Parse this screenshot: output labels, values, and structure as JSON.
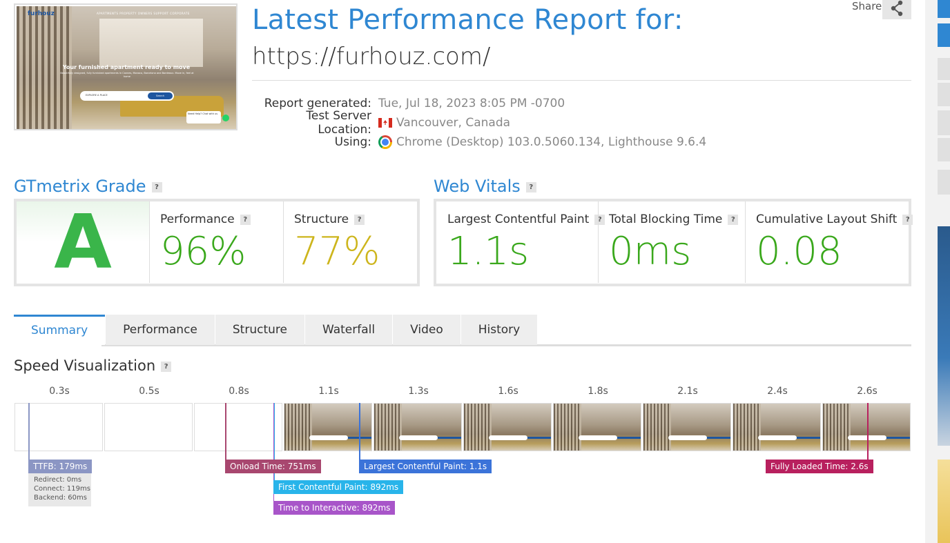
{
  "screenshot": {
    "logo": "furhouz",
    "nav": "APARTMENTS   PROPERTY OWNERS   SUPPORT   CORPORATE",
    "headline": "Your furnished apartment ready to move",
    "subtext": "Beautifully designed, fully furnished apartments in Cannes, Monaco, Barcelona and Bordeaux. Move in, feel at home",
    "search_placeholder": "EXPLORE A PLACE",
    "search_button": "Search",
    "chat": "Need Help? Chat with us"
  },
  "header": {
    "title": "Latest Performance Report for:",
    "url": "https://furhouz.com/",
    "share_label": "Share"
  },
  "meta": {
    "generated_label": "Report generated:",
    "generated_value": "Tue, Jul 18, 2023 8:05 PM -0700",
    "location_label": "Test Server Location:",
    "location_value": "Vancouver, Canada",
    "using_label": "Using:",
    "using_value": "Chrome (Desktop) 103.0.5060.134, Lighthouse 9.6.4"
  },
  "grade": {
    "heading": "GTmetrix Grade",
    "letter": "A",
    "performance_label": "Performance",
    "performance_value": "96%",
    "structure_label": "Structure",
    "structure_value": "77%",
    "colors": {
      "grade": "#3ab54a",
      "performance": "#3aa81c",
      "structure": "#cdb51c"
    }
  },
  "vitals": {
    "heading": "Web Vitals",
    "lcp_label": "Largest Contentful Paint",
    "lcp_value": "1.1s",
    "tbt_label": "Total Blocking Time",
    "tbt_value": "0ms",
    "cls_label": "Cumulative Layout Shift",
    "cls_value": "0.08",
    "color": "#3aa81c"
  },
  "help": "?",
  "tabs": [
    "Summary",
    "Performance",
    "Structure",
    "Waterfall",
    "Video",
    "History"
  ],
  "speed": {
    "heading": "Speed Visualization",
    "frame_times": [
      "0.3s",
      "0.5s",
      "0.8s",
      "1.1s",
      "1.3s",
      "1.6s",
      "1.8s",
      "2.1s",
      "2.4s",
      "2.6s"
    ],
    "ttfb": "TTFB: 179ms",
    "redirect": "Redirect: 0ms",
    "connect": "Connect: 119ms",
    "backend": "Backend: 60ms",
    "onload": "Onload Time: 751ms",
    "lcp": "Largest Contentful Paint: 1.1s",
    "fully_loaded": "Fully Loaded Time: 2.6s",
    "fcp": "First Contentful Paint: 892ms",
    "tti": "Time to Interactive: 892ms",
    "colors": {
      "ttfb": "#8b96c4",
      "onload": "#a8476f",
      "lcp": "#3b73d9",
      "fully_loaded": "#b8205e",
      "fcp": "#28b4ea",
      "tti": "#a855c9"
    }
  }
}
